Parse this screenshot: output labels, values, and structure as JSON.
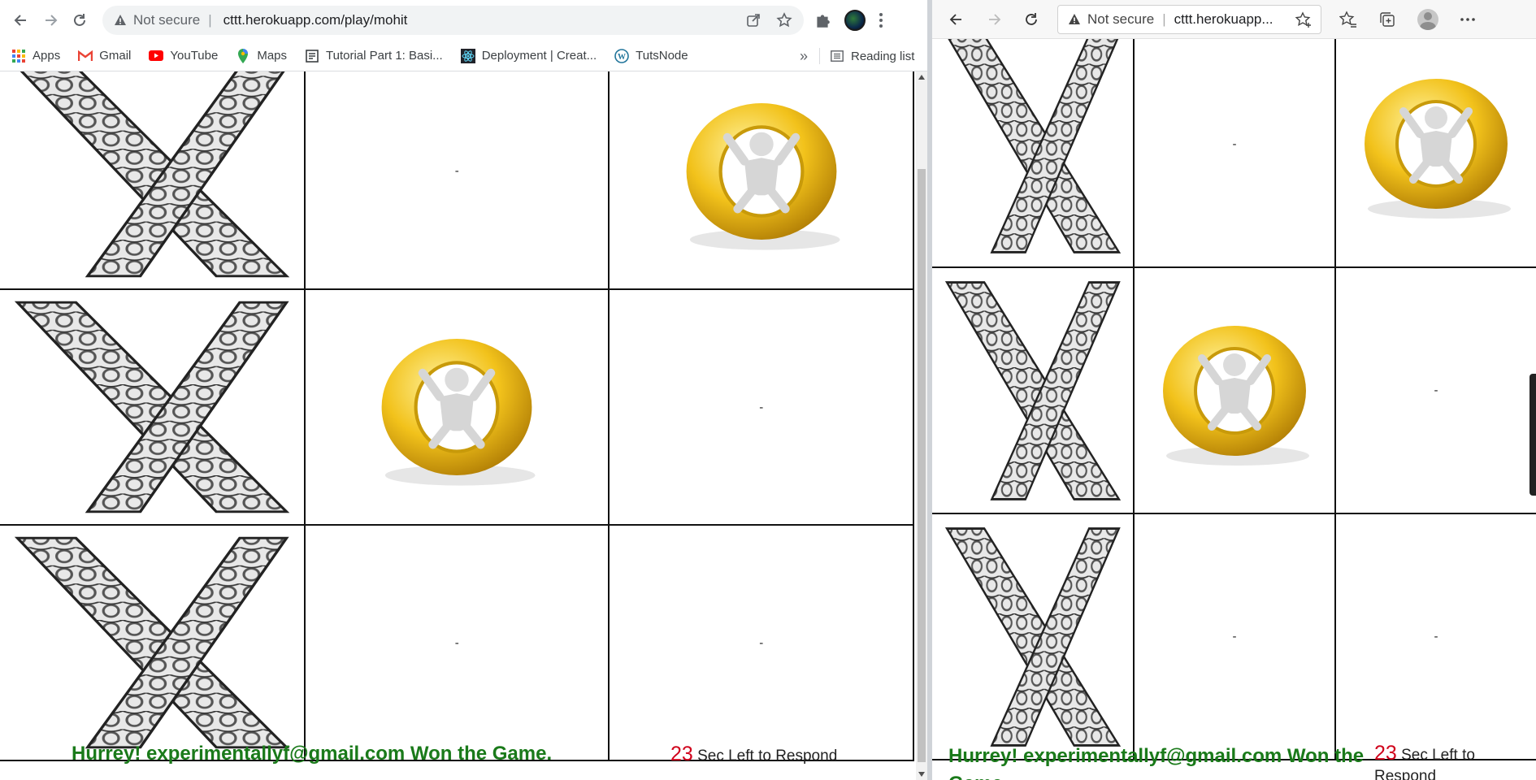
{
  "left_browser": {
    "security_label": "Not secure",
    "url": "cttt.herokuapp.com/play/mohit",
    "bookmarks": [
      {
        "label": "Apps",
        "icon": "apps-grid-icon"
      },
      {
        "label": "Gmail",
        "icon": "gmail-icon"
      },
      {
        "label": "YouTube",
        "icon": "youtube-icon"
      },
      {
        "label": "Maps",
        "icon": "maps-icon"
      },
      {
        "label": "Tutorial Part 1: Basi...",
        "icon": "document-icon"
      },
      {
        "label": "Deployment | Creat...",
        "icon": "react-icon"
      },
      {
        "label": "TutsNode",
        "icon": "wordpress-icon"
      }
    ],
    "more_bookmarks": "»",
    "reading_list": "Reading list",
    "board": [
      [
        "X",
        "-",
        "O"
      ],
      [
        "X",
        "O",
        "-"
      ],
      [
        "X",
        "-",
        "-"
      ]
    ],
    "message": "Hurrey! experimentallyf@gmail.com Won the Game.",
    "timer_value": "23",
    "timer_text": " Sec Left to Respond"
  },
  "right_browser": {
    "security_label": "Not secure",
    "url": "cttt.herokuapp...",
    "board": [
      [
        "X",
        "-",
        "O"
      ],
      [
        "X",
        "O",
        "-"
      ],
      [
        "X",
        "-",
        "-"
      ]
    ],
    "message": "Hurrey! experimentallyf@gmail.com Won the Game.",
    "timer_value": "23",
    "timer_text": " Sec Left to Respond"
  },
  "colors": {
    "win_message": "#1a7a1a",
    "timer_number": "#d0021b",
    "o_gold": "#f2c21b"
  }
}
